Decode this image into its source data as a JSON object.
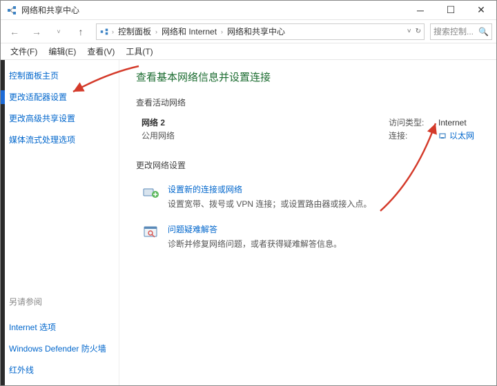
{
  "window": {
    "title": "网络和共享中心"
  },
  "nav": {
    "crumb1": "控制面板",
    "crumb2": "网络和 Internet",
    "crumb3": "网络和共享中心",
    "search_placeholder": "搜索控制..."
  },
  "menu": {
    "file": "文件(F)",
    "edit": "编辑(E)",
    "view": "查看(V)",
    "tools": "工具(T)"
  },
  "sidebar": {
    "home": "控制面板主页",
    "adapter": "更改适配器设置",
    "advanced": "更改高级共享设置",
    "media": "媒体流式处理选项",
    "seealso": "另请参阅",
    "internet": "Internet 选项",
    "defender": "Windows Defender 防火墙",
    "infrared": "红外线"
  },
  "main": {
    "heading": "查看基本网络信息并设置连接",
    "active_nets": "查看活动网络",
    "net": {
      "name": "网络 2",
      "type": "公用网络",
      "access_label": "访问类型:",
      "access_value": "Internet",
      "conn_label": "连接:",
      "conn_value": "以太网"
    },
    "change_settings": "更改网络设置",
    "setup": {
      "title": "设置新的连接或网络",
      "desc": "设置宽带、拨号或 VPN 连接；或设置路由器或接入点。"
    },
    "trouble": {
      "title": "问题疑难解答",
      "desc": "诊断并修复网络问题，或者获得疑难解答信息。"
    }
  }
}
